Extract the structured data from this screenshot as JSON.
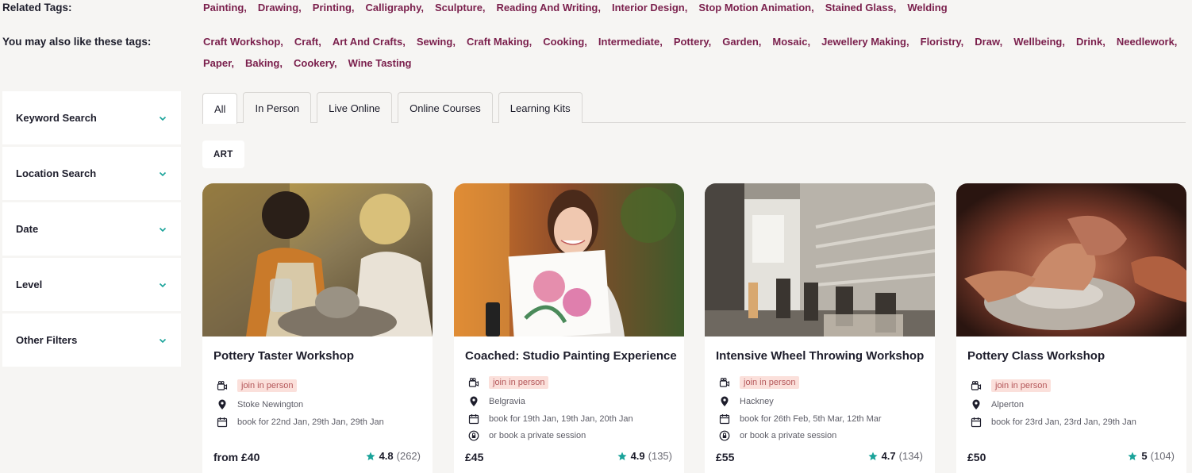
{
  "related_tags": {
    "label": "Related Tags:",
    "items": [
      "Painting,",
      "Drawing,",
      "Printing,",
      "Calligraphy,",
      "Sculpture,",
      "Reading And Writing,",
      "Interior Design,",
      "Stop Motion Animation,",
      "Stained Glass,",
      "Welding"
    ]
  },
  "also_tags": {
    "label": "You may also like these tags:",
    "items": [
      "Craft Workshop,",
      "Craft,",
      "Art And Crafts,",
      "Sewing,",
      "Craft Making,",
      "Cooking,",
      "Intermediate,",
      "Pottery,",
      "Garden,",
      "Mosaic,",
      "Jewellery Making,",
      "Floristry,",
      "Draw,",
      "Wellbeing,",
      "Drink,",
      "Needlework,",
      "Paper,",
      "Baking,",
      "Cookery,",
      "Wine Tasting"
    ]
  },
  "filters": [
    "Keyword Search",
    "Location Search",
    "Date",
    "Level",
    "Other Filters"
  ],
  "tabs": [
    "All",
    "In Person",
    "Live Online",
    "Online Courses",
    "Learning Kits"
  ],
  "active_tab": "All",
  "category_chip": "ART",
  "colors": {
    "tag": "#7a1f4c",
    "accent": "#1aa39a",
    "badge_bg": "#fbe0db",
    "badge_text": "#b4575a"
  },
  "cards": [
    {
      "title": "Pottery Taster Workshop",
      "badge": "join in person",
      "location": "Stoke Newington",
      "dates": "book for 22nd Jan, 29th Jan, 29th Jan",
      "private": "",
      "price": "from £40",
      "rating": "4.8",
      "reviews": "(262)",
      "image": "pottery-couple-photo"
    },
    {
      "title": "Coached: Studio Painting Experience",
      "badge": "join in person",
      "location": "Belgravia",
      "dates": "book for 19th Jan, 19th Jan, 20th Jan",
      "private": "or book a private session",
      "price": "£45",
      "rating": "4.9",
      "reviews": "(135)",
      "image": "woman-with-painting-photo"
    },
    {
      "title": "Intensive Wheel Throwing Workshop",
      "badge": "join in person",
      "location": "Hackney",
      "dates": "book for 26th Feb, 5th Mar, 12th Mar",
      "private": "or book a private session",
      "price": "£55",
      "rating": "4.7",
      "reviews": "(134)",
      "image": "pottery-studio-photo"
    },
    {
      "title": "Pottery Class Workshop",
      "badge": "join in person",
      "location": "Alperton",
      "dates": "book for 23rd Jan, 23rd Jan, 29th Jan",
      "private": "",
      "price": "£50",
      "rating": "5",
      "reviews": "(104)",
      "image": "hands-clay-photo"
    }
  ]
}
